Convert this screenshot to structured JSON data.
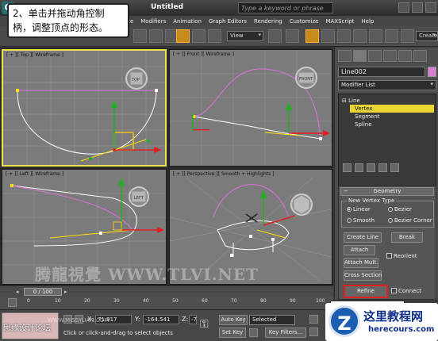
{
  "app": {
    "logo_letter": "G",
    "title": "Untitled",
    "search_placeholder": "Type a keyword or phrase"
  },
  "menu": [
    "Create",
    "Modifiers",
    "Animation",
    "Graph Editors",
    "Rendering",
    "Customize",
    "MAXScript",
    "Help"
  ],
  "toolbar": {
    "view_select": "View",
    "create_select": "Create"
  },
  "callout": {
    "line1": "2、单击并拖动角控制",
    "line2": "柄，调整顶点的形态。"
  },
  "viewports": {
    "top": {
      "label": "[ + ][ Top ][ Wireframe ]",
      "cube": "TOP"
    },
    "front": {
      "label": "[ + ][ Front ][ Wireframe ]",
      "cube": "FRONT"
    },
    "left": {
      "label": "[ + ][ Left ][ Wireframe ]",
      "cube": "LEFT"
    },
    "perspective": {
      "label": "[ + ][ Perspective ][ Smooth + Highlights ]"
    }
  },
  "command_panel": {
    "object_name": "Line002",
    "modifier_list": "Modifier List",
    "stack": [
      "Line",
      "Vertex",
      "Segment",
      "Spline"
    ],
    "geometry_title": "Geometry",
    "vertex_type_title": "New Vertex Type",
    "vertex_types": [
      "Linear",
      "Bezier",
      "Smooth",
      "Bezier Corner"
    ],
    "buttons": {
      "create_line": "Create Line",
      "break": "Break",
      "attach": "Attach",
      "reorient": "Reorient",
      "attach_mult": "Attach Mult.",
      "cross_section": "Cross Section",
      "refine": "Refine",
      "connect": "Connect"
    }
  },
  "timeline": {
    "frame": "0 / 100",
    "ticks": [
      "0",
      "10",
      "20",
      "30",
      "40",
      "50",
      "60",
      "70",
      "80",
      "90",
      "100"
    ]
  },
  "status": {
    "x_label": "X:",
    "x_value": "71.917",
    "y_label": "Y:",
    "y_value": "-164.541",
    "z_label": "Z:",
    "z_value": "-7",
    "auto_key": "Auto Key",
    "selected": "Selected",
    "set_key": "Set Key",
    "key_filters": "Key Filters...",
    "message": "Click or click-and-drag to select objects"
  },
  "watermarks": {
    "center": "腾龍視覺 WWW.TLVI.NET",
    "missyuan": "WWW.MISSYUAN.COM",
    "cn_forum": "思缘设计论坛"
  },
  "brand": {
    "logo_letter": "Z",
    "name": "这里教程网",
    "url": "herecours.com"
  }
}
